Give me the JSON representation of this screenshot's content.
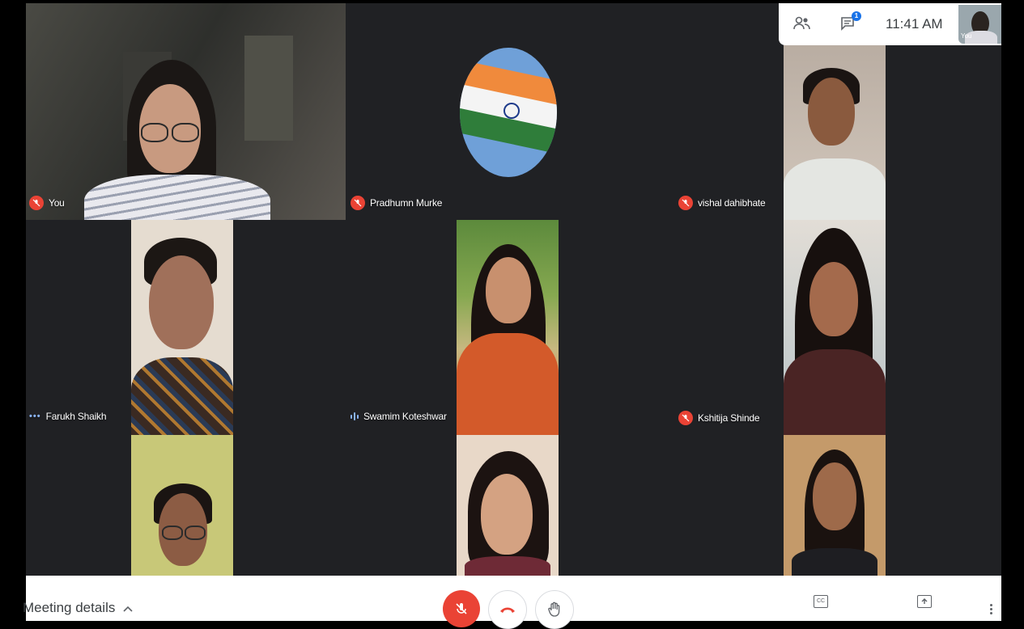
{
  "top_bar": {
    "people_icon": "people-icon",
    "chat_icon": "chat-icon",
    "chat_badge": "1",
    "time": "11:41 AM",
    "self_label": "You"
  },
  "participants": [
    {
      "name": "You",
      "status": "muted"
    },
    {
      "name": "Pradhumn Murke",
      "status": "muted"
    },
    {
      "name": "vishal dahibhate",
      "status": "muted"
    },
    {
      "name": "Farukh Shaikh",
      "status": "idle"
    },
    {
      "name": "Swamim Koteshwar",
      "status": "speaking"
    },
    {
      "name": "Kshitija Shinde",
      "status": "muted"
    }
  ],
  "bottom_bar": {
    "meeting_details": "Meeting details",
    "mic_button": "mic-off-icon",
    "hangup_button": "hangup-icon",
    "present_button": "present-icon",
    "captions_label": "CC",
    "present_now": "present-now-icon",
    "more_options": "more-options-icon"
  },
  "colors": {
    "stage": "#202124",
    "mute_red": "#ea4335",
    "speaking_blue": "#8ab4f8"
  }
}
